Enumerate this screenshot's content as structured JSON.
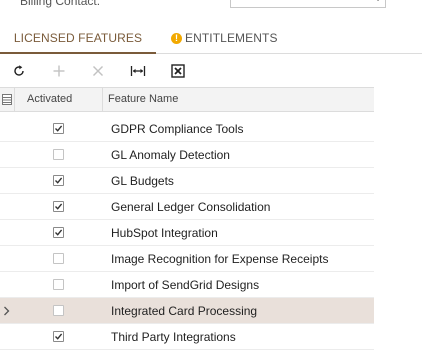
{
  "top": {
    "label": "Billing Contact:"
  },
  "tabs": {
    "licensed": "LICENSED FEATURES",
    "entitlements": "ENTITLEMENTS"
  },
  "toolbar": {
    "refresh": "refresh-icon",
    "add": "plus-icon",
    "delete": "close-icon",
    "fit": "fit-columns-icon",
    "excel": "excel-export-icon"
  },
  "grid": {
    "columns": [
      "Activated",
      "Feature Name"
    ],
    "rows": [
      {
        "activated": true,
        "feature": "GDPR Compliance Tools",
        "selected": false
      },
      {
        "activated": false,
        "feature": "GL Anomaly Detection",
        "selected": false
      },
      {
        "activated": true,
        "feature": "GL Budgets",
        "selected": false
      },
      {
        "activated": true,
        "feature": "General Ledger Consolidation",
        "selected": false
      },
      {
        "activated": true,
        "feature": "HubSpot Integration",
        "selected": false
      },
      {
        "activated": false,
        "feature": "Image Recognition for Expense Receipts",
        "selected": false
      },
      {
        "activated": false,
        "feature": "Import of SendGrid Designs",
        "selected": false
      },
      {
        "activated": false,
        "feature": "Integrated Card Processing",
        "selected": true
      },
      {
        "activated": true,
        "feature": "Third Party Integrations",
        "selected": false
      }
    ]
  },
  "colors": {
    "accent": "#7a5b3a",
    "selected_row": "#e9e0da",
    "warning": "#f2a900"
  }
}
